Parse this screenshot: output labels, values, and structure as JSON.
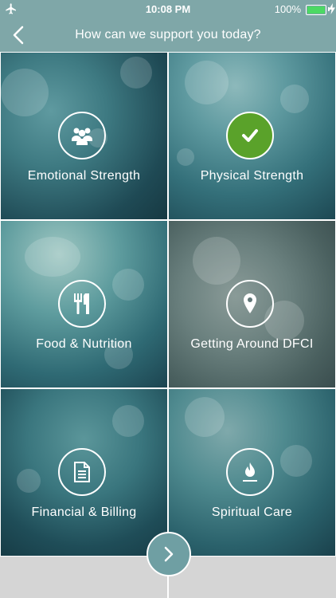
{
  "status_bar": {
    "time": "10:08 PM",
    "battery_percent": "100%",
    "icons": [
      "airplane-icon",
      "battery-icon",
      "charging-bolt-icon"
    ]
  },
  "header": {
    "back_icon": "chevron-left-icon",
    "title": "How can we support you today?"
  },
  "tiles": [
    {
      "label": "Emotional Strength",
      "icon": "people-icon",
      "selected": false
    },
    {
      "label": "Physical Strength",
      "icon": "checkmark-icon",
      "selected": true
    },
    {
      "label": "Food & Nutrition",
      "icon": "fork-knife-icon",
      "selected": false
    },
    {
      "label": "Getting Around DFCI",
      "icon": "map-pin-icon",
      "selected": false
    },
    {
      "label": "Financial & Billing",
      "icon": "document-icon",
      "selected": false
    },
    {
      "label": "Spiritual Care",
      "icon": "flame-icon",
      "selected": false
    }
  ],
  "footer": {
    "next_icon": "chevron-right-icon"
  },
  "colors": {
    "header_bg": "#7fa7a8",
    "selected_accent": "#5aa22a",
    "next_button": "#6f9fa3"
  }
}
